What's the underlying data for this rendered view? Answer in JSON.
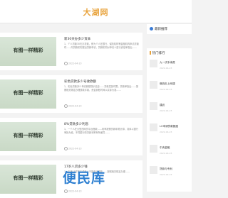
{
  "site": {
    "logo": "大湖网"
  },
  "articles": [
    {
      "thumb_text": "有图一样精彩",
      "title": "新30天办多少资本",
      "desc": "1、个人贷款30天办贷款，即为个人在银行、保险机构等金融机构申请贷款时……向贷款机构提出贷款申请，贷款机构对申请人进行资信审查后……",
      "date": "2022-04-23"
    },
    {
      "thumb_text": "有图一样精彩",
      "title": "彩色贷款多少号收款额",
      "desc": "1、彩色贷款多少号收款额提示信息……贷款发放时限，贷款审批后……按照相关规定办理放款手续，资金到账时间以实际为准……",
      "date": "2022-04-23"
    },
    {
      "thumb_text": "有图一样精彩",
      "title": "8%贷款多少利息",
      "desc": "1、一个人在大型的网贷平台借款……利率按照贷款年限计算，具体以银行审批为准，不同银行的贷款利率有所差异……",
      "date": "2022-04-23"
    },
    {
      "thumb_text": "有图一样精彩",
      "title": "17岁八贷多少钱",
      "desc": "1、未满18岁的未成年人不能申请贷款……按照相关规定办理……",
      "date": "2022-04-23"
    }
  ],
  "sidebar": {
    "recommend_title": "最新推荐",
    "hot_title": "热门排行",
    "hot_items": [
      {
        "title": "九一试手续费",
        "date": "2022-04-23"
      },
      {
        "title": "借钱去上网课",
        "date": "2022-04-23"
      },
      {
        "title": "建武",
        "date": "2022-04-23"
      },
      {
        "title": "LC申请贷款额度",
        "date": "2022-04-23"
      },
      {
        "title": "中央金融",
        "date": "2022-04-23"
      },
      {
        "title": "贷款与专利",
        "date": "2022-04-23"
      }
    ]
  },
  "watermark": {
    "text": "便民库",
    "sub": ""
  },
  "colors": {
    "accent": "#e8a23a",
    "link": "#3a7bd5",
    "watermark": "#2f80d1"
  }
}
